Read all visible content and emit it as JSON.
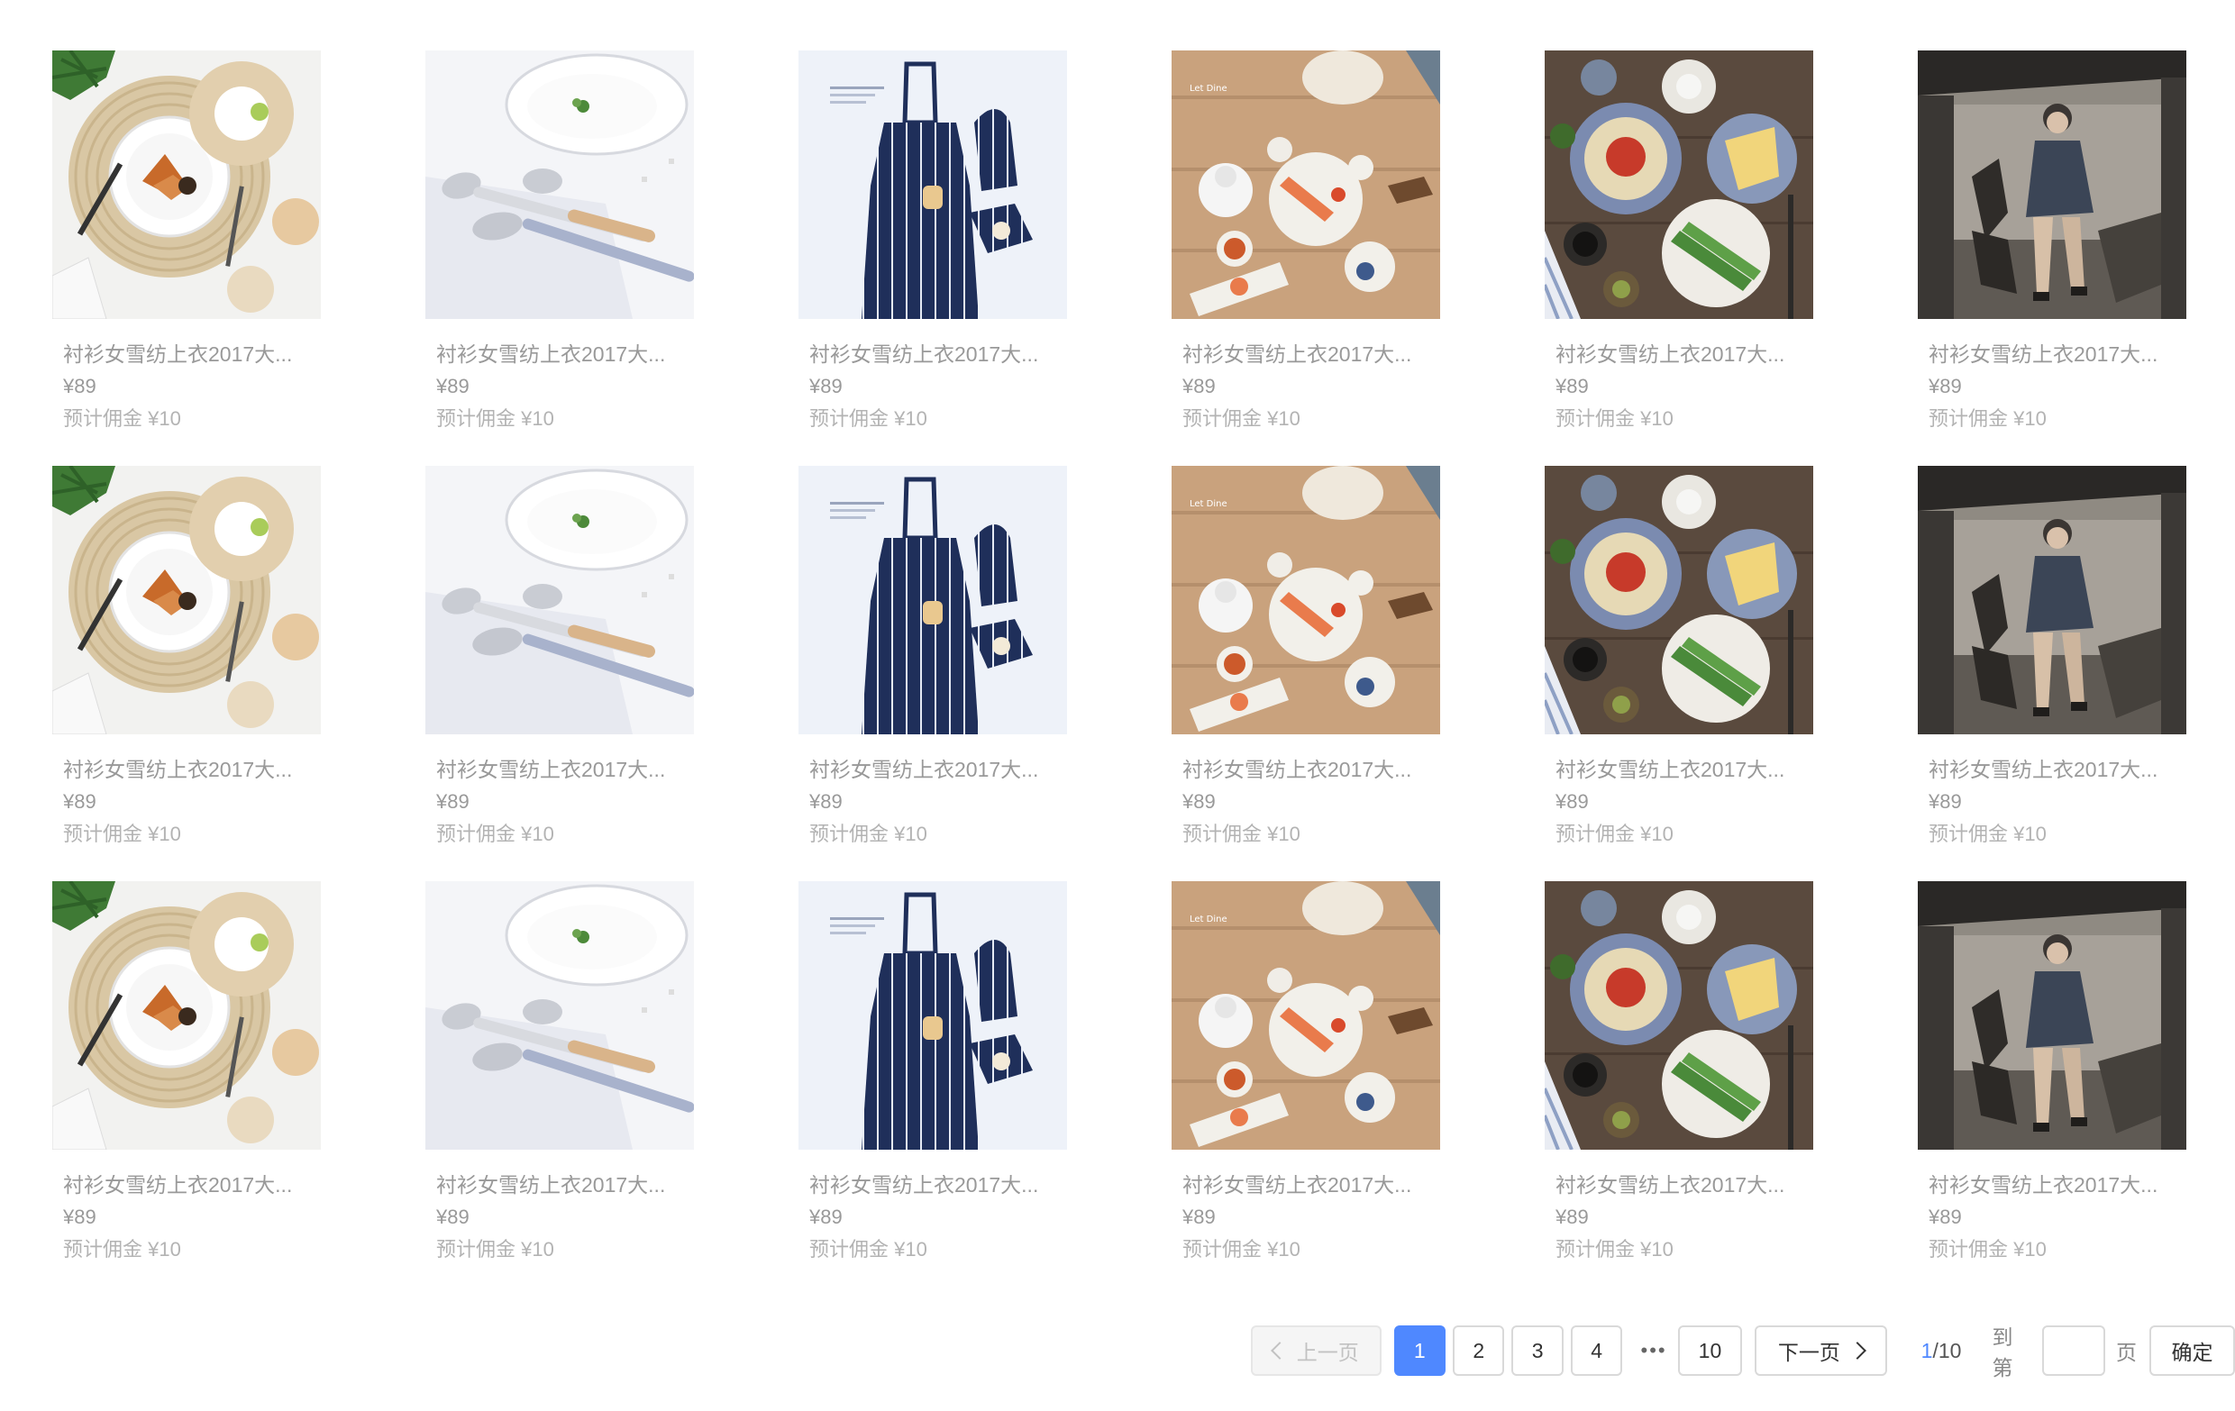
{
  "products": [
    {
      "title": "衬衫女雪纺上衣2017大...",
      "price": "¥89",
      "commission": "预计佣金 ¥10",
      "image": "breakfast-placemat"
    },
    {
      "title": "衬衫女雪纺上衣2017大...",
      "price": "¥89",
      "commission": "预计佣金 ¥10",
      "image": "cutlery-plate"
    },
    {
      "title": "衬衫女雪纺上衣2017大...",
      "price": "¥89",
      "commission": "预计佣金 ¥10",
      "image": "striped-apron"
    },
    {
      "title": "衬衫女雪纺上衣2017大...",
      "price": "¥89",
      "commission": "预计佣金 ¥10",
      "image": "wooden-table-dishes"
    },
    {
      "title": "衬衫女雪纺上衣2017大...",
      "price": "¥89",
      "commission": "预计佣金 ¥10",
      "image": "dark-table-dishes"
    },
    {
      "title": "衬衫女雪纺上衣2017大...",
      "price": "¥89",
      "commission": "预计佣金 ¥10",
      "image": "fashion-model"
    },
    {
      "title": "衬衫女雪纺上衣2017大...",
      "price": "¥89",
      "commission": "预计佣金 ¥10",
      "image": "breakfast-placemat"
    },
    {
      "title": "衬衫女雪纺上衣2017大...",
      "price": "¥89",
      "commission": "预计佣金 ¥10",
      "image": "cutlery-plate"
    },
    {
      "title": "衬衫女雪纺上衣2017大...",
      "price": "¥89",
      "commission": "预计佣金 ¥10",
      "image": "striped-apron"
    },
    {
      "title": "衬衫女雪纺上衣2017大...",
      "price": "¥89",
      "commission": "预计佣金 ¥10",
      "image": "wooden-table-dishes"
    },
    {
      "title": "衬衫女雪纺上衣2017大...",
      "price": "¥89",
      "commission": "预计佣金 ¥10",
      "image": "dark-table-dishes"
    },
    {
      "title": "衬衫女雪纺上衣2017大...",
      "price": "¥89",
      "commission": "预计佣金 ¥10",
      "image": "fashion-model"
    },
    {
      "title": "衬衫女雪纺上衣2017大...",
      "price": "¥89",
      "commission": "预计佣金 ¥10",
      "image": "breakfast-placemat"
    },
    {
      "title": "衬衫女雪纺上衣2017大...",
      "price": "¥89",
      "commission": "预计佣金 ¥10",
      "image": "cutlery-plate"
    },
    {
      "title": "衬衫女雪纺上衣2017大...",
      "price": "¥89",
      "commission": "预计佣金 ¥10",
      "image": "striped-apron"
    },
    {
      "title": "衬衫女雪纺上衣2017大...",
      "price": "¥89",
      "commission": "预计佣金 ¥10",
      "image": "wooden-table-dishes"
    },
    {
      "title": "衬衫女雪纺上衣2017大...",
      "price": "¥89",
      "commission": "预计佣金 ¥10",
      "image": "dark-table-dishes"
    },
    {
      "title": "衬衫女雪纺上衣2017大...",
      "price": "¥89",
      "commission": "预计佣金 ¥10",
      "image": "fashion-model"
    }
  ],
  "pagination": {
    "prev_label": "上一页",
    "next_label": "下一页",
    "pages": [
      "1",
      "2",
      "3",
      "4"
    ],
    "active_page": "1",
    "ellipsis": "•••",
    "last_page": "10",
    "current": "1",
    "total": "/10",
    "goto_label": "到第",
    "goto_value": "",
    "page_unit": "页",
    "confirm_label": "确定",
    "accent_color": "#4f88ff"
  }
}
